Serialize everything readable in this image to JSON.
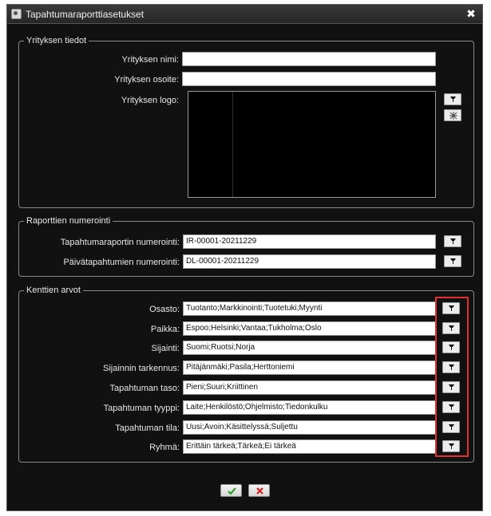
{
  "window": {
    "title": "Tapahtumaraporttiasetukset",
    "close_glyph": "✖"
  },
  "company": {
    "legend": "Yrityksen tiedot",
    "name_label": "Yrityksen nimi:",
    "name_value": "",
    "address_label": "Yrityksen osoite:",
    "address_value": "",
    "logo_label": "Yrityksen logo:"
  },
  "numbering": {
    "legend": "Raporttien numerointi",
    "rows": [
      {
        "label": "Tapahtumaraportin numerointi:",
        "value": "IR-00001-20211229"
      },
      {
        "label": "Päivätapahtumien numerointi:",
        "value": "DL-00001-20211229"
      }
    ]
  },
  "fields": {
    "legend": "Kenttien arvot",
    "rows": [
      {
        "label": "Osasto:",
        "value": "Tuotanto;Markkinointi;Tuotetuki;Myynti"
      },
      {
        "label": "Paikka:",
        "value": "Espoo;Helsinki;Vantaa;Tukholma;Oslo"
      },
      {
        "label": "Sijainti:",
        "value": "Suomi;Ruotsi;Norja"
      },
      {
        "label": "Sijainnin tarkennus:",
        "value": "Pitäjänmäki;Pasila;Herttoniemi"
      },
      {
        "label": "Tapahtuman taso:",
        "value": "Pieni;Suuri;Kriittinen"
      },
      {
        "label": "Tapahtuman tyyppi:",
        "value": "Laite;Henkilöstö;Ohjelmisto;Tiedonkulku"
      },
      {
        "label": "Tapahtuman tila:",
        "value": "Uusi;Avoin;Käsittelyssä;Suljettu"
      },
      {
        "label": "Ryhmä:",
        "value": "Erittäin tärkeä;Tärkeä;Ei tärkeä"
      }
    ]
  },
  "colors": {
    "background": "#111111",
    "highlight": "#e23030",
    "ok": "#2ea02e",
    "cancel": "#d82020"
  },
  "icons": {
    "edit": "pencil-icon",
    "clear": "clear-icon",
    "ok": "checkmark-icon",
    "cancel": "x-icon"
  }
}
